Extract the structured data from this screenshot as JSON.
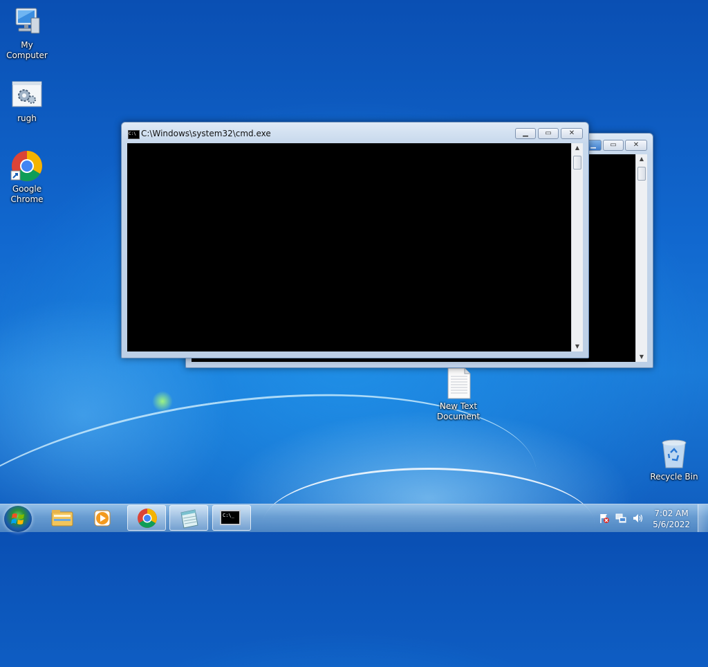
{
  "desktop": {
    "icons": [
      {
        "label": "My Computer",
        "icon": "computer-icon"
      },
      {
        "label": "rugh",
        "icon": "settings-shortcut-icon"
      },
      {
        "label": "Google Chrome",
        "icon": "chrome-icon"
      },
      {
        "label": "New Text Document",
        "icon": "text-document-icon"
      },
      {
        "label": "Recycle Bin",
        "icon": "recycle-bin-icon"
      }
    ]
  },
  "windows": {
    "front": {
      "title": "C:\\Windows\\system32\\cmd.exe",
      "icon_text": "C:\\"
    },
    "back": {
      "title": ""
    }
  },
  "taskbar": {
    "buttons": [
      {
        "icon": "file-explorer-icon",
        "active": false
      },
      {
        "icon": "media-player-icon",
        "active": false
      },
      {
        "icon": "chrome-icon",
        "active": true
      },
      {
        "icon": "notepad-icon",
        "active": true
      },
      {
        "icon": "command-prompt-icon",
        "active": true,
        "text": "C:\\_"
      }
    ],
    "tray": {
      "icons": [
        "action-center-flag-icon",
        "network-icon",
        "volume-icon"
      ],
      "time": "7:02 AM",
      "date": "5/6/2022"
    }
  },
  "colors": {
    "desktop": "#1168cf",
    "console": "#000000",
    "accent": "#2a8f3a"
  }
}
